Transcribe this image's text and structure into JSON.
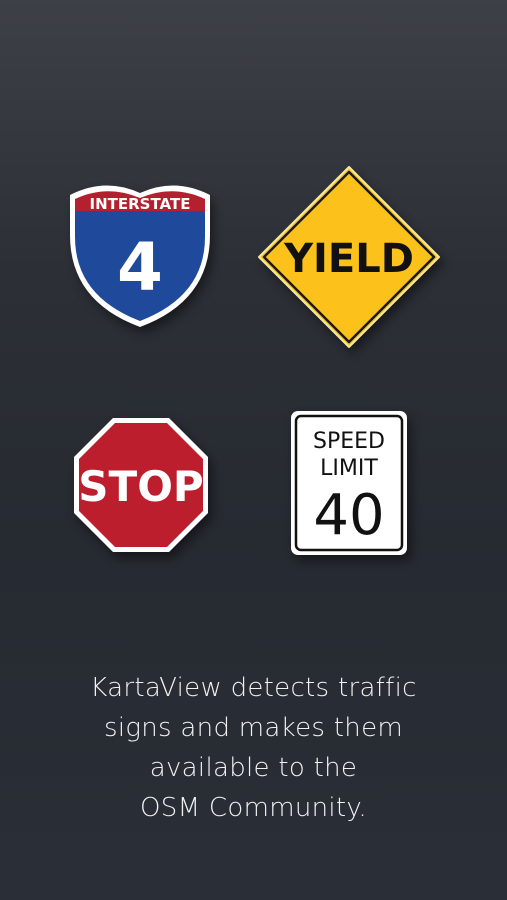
{
  "signs": {
    "interstate": {
      "top_text": "INTERSTATE",
      "number": "4",
      "red": "#b5202e",
      "blue": "#1f4a9c"
    },
    "yield": {
      "text": "YIELD",
      "fill": "#fcc21b"
    },
    "stop": {
      "text": "STOP",
      "fill": "#bd1e2d"
    },
    "speed_limit": {
      "line1": "SPEED",
      "line2": "LIMIT",
      "value": "40"
    }
  },
  "caption": {
    "line1": "KartaView detects traffic",
    "line2": "signs and makes them",
    "line3": "available to the",
    "line4": "OSM Community."
  }
}
